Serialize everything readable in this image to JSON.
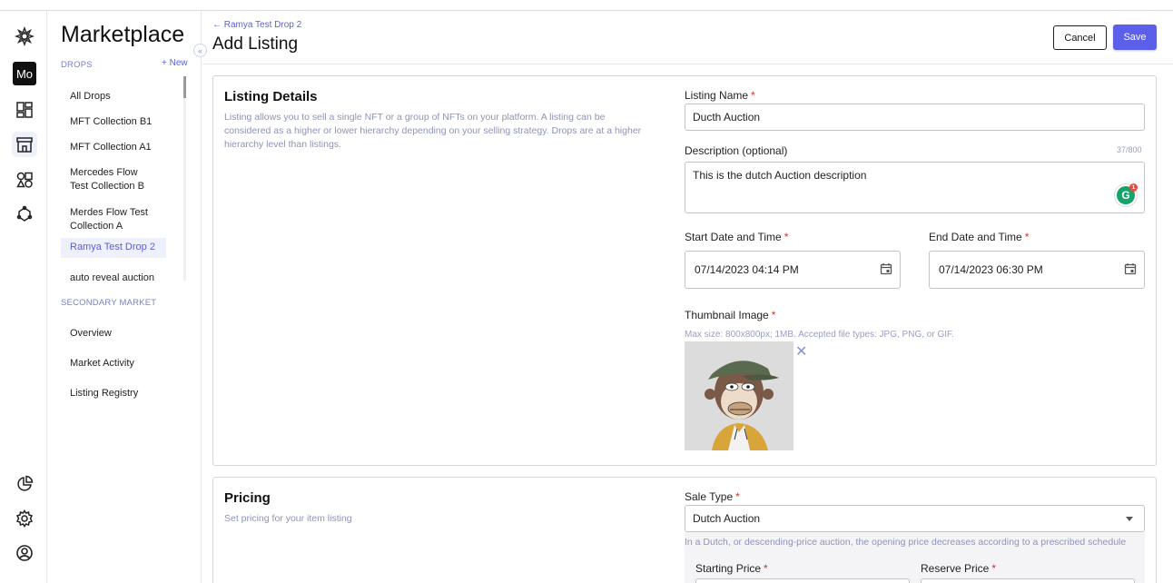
{
  "rail": {
    "org_label": "Mo"
  },
  "sidebar": {
    "title": "Marketplace",
    "drops_section": "DROPS",
    "new_label": "+ New",
    "drops": [
      {
        "label": "All Drops"
      },
      {
        "label": "MFT Collection B1"
      },
      {
        "label": "MFT Collection A1"
      },
      {
        "label": "Mercedes Flow Test Collection B"
      },
      {
        "label": "Merdes Flow Test Collection A"
      },
      {
        "label": "Ramya Test Drop 2"
      },
      {
        "label": "auto reveal auction"
      }
    ],
    "secondary_section": "SECONDARY MARKET",
    "secondary": [
      {
        "label": "Overview"
      },
      {
        "label": "Market Activity"
      },
      {
        "label": "Listing Registry"
      }
    ],
    "collapse_glyph": "«"
  },
  "header": {
    "breadcrumb": "← Ramya Test Drop 2",
    "title": "Add Listing",
    "cancel_label": "Cancel",
    "save_label": "Save"
  },
  "listing_details": {
    "title": "Listing Details",
    "description": "Listing allows you to sell a single NFT or a group of NFTs on your platform. A listing can be considered as a higher or lower hierarchy depending on your selling strategy. Drops are at a higher hierarchy level than listings.",
    "name_label": "Listing Name",
    "name_value": "Ducth Auction",
    "desc_label": "Description (optional)",
    "desc_counter": "37/800",
    "desc_value": "This is the dutch Auction description",
    "start_label": "Start Date and Time",
    "start_value": "07/14/2023 04:14 PM",
    "end_label": "End Date and Time",
    "end_value": "07/14/2023 06:30 PM",
    "thumb_label": "Thumbnail Image",
    "thumb_hint": "Max size: 800x800px; 1MB. Accepted file types: JPG, PNG, or GIF.",
    "remove_glyph": "✕",
    "required_mark": "*"
  },
  "pricing": {
    "title": "Pricing",
    "description": "Set pricing for your item listing",
    "sale_type_label": "Sale Type",
    "sale_type_value": "Dutch Auction",
    "sale_type_hint": "In a Dutch, or descending-price auction, the opening price decreases according to a prescribed schedule",
    "starting_price_label": "Starting Price",
    "reserve_price_label": "Reserve Price"
  },
  "colors": {
    "accent": "#5b5fe9",
    "required": "#d32f2f",
    "muted_text": "#8f93b8"
  }
}
